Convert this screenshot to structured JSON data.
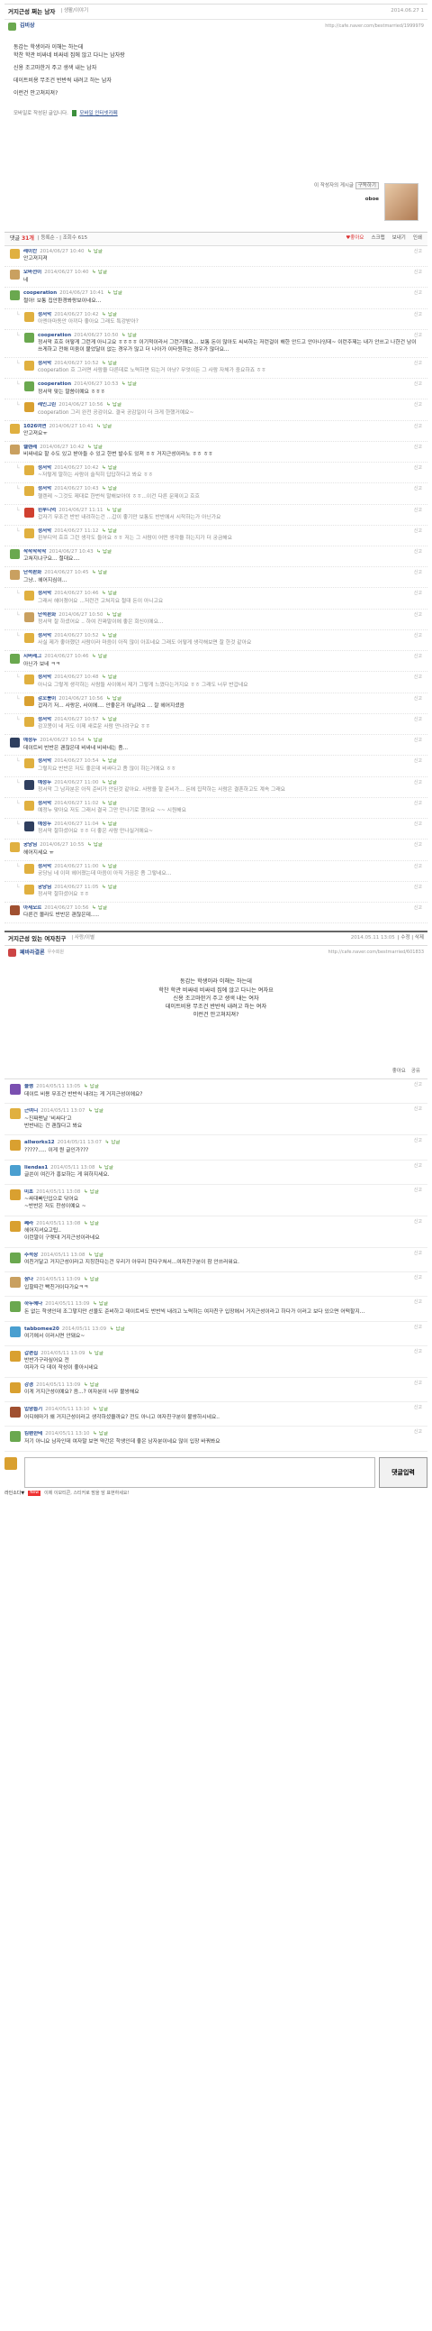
{
  "post1": {
    "title": "거지근성 쩌는 남자",
    "category": "| 생활/이야기",
    "date": "2014.06.27 1",
    "author": "김비상",
    "url": "http://cafe.naver.com/bestmarried/1999979",
    "lines": [
      "동갑는 학생이라 이해는 하는데",
      "학찬 학관 비싸네 비싸네 집에 않고 다니는 남자랑",
      "신용 조고마한거 주고 생색 내는 남자",
      "데이트비용 무조건 반반씩 내려고 하는 남자",
      "이런건 안고쳐지져?"
    ],
    "tag_prefix": "모바일로 작성된 글입니다.",
    "tag_link": "모바일 인터넷카페"
  },
  "profile": {
    "meta1": "이 작성자의 게시글",
    "meta2": "구독하기",
    "name": "oboe"
  },
  "comment_bar": {
    "label": "댓글",
    "count": "31개",
    "rest": "| 등록순 - | 조회수 615",
    "tools": [
      "♥좋아요",
      "스크랩",
      "보내기",
      "인쇄"
    ]
  },
  "comments": [
    {
      "name": "레이칸",
      "date": "2014/06/27 10:40",
      "text": "안고져지져",
      "reply": false,
      "color": "#e0b040",
      "dim": false
    },
    {
      "name": "오바전이",
      "date": "2014/06/27 10:40",
      "text": "네",
      "reply": false,
      "color": "#c9a060",
      "dim": false
    },
    {
      "name": "cooperation",
      "date": "2014/06/27 10:41",
      "text": "절아! 보통 집안환경봐랑보이네요...",
      "reply": false,
      "color": "#6aa84f",
      "dim": false
    },
    {
      "name": "정서막",
      "date": "2014/06/27 10:42",
      "text": "아엔아마동안 아끼다 좋아요 그래도 특강받아?",
      "reply": true,
      "color": "#e0b040",
      "dim": true
    },
    {
      "name": "cooperation",
      "date": "2014/06/27 10:50",
      "text": "정서막 흐흐 어떻게 그런게 아니고요 ㅎㅎㅎㅎ 이기적이라서 그런거예요... 보통 돈이 많아도 씨씨하는 저런걸이 해한 안드고 안아나잉데~ 이런주제는 내가 안쓰고 나한건 남이 쓰게하고 전애 미움이 붙었달이 없는 경우가 많고 더 나아가 이타원하는 경우가 많더요...",
      "reply": true,
      "color": "#6aa84f",
      "dim": false
    },
    {
      "name": "정서막",
      "date": "2014/06/27 10:52",
      "text": "cooperation 흐 그러면 사람을 다른데로 노력하면 되는거 아냥? 무엇이든 그 사람 자체가 중요하죠 ㅎㅎ",
      "reply": true,
      "color": "#e0b040",
      "dim": true
    },
    {
      "name": "cooperation",
      "date": "2014/06/27 10:53",
      "text": "정서막 맞는 말씀이예요 ㅎㅎㅎ",
      "reply": true,
      "color": "#6aa84f",
      "dim": false
    },
    {
      "name": "레인그린",
      "date": "2014/06/27 10:56",
      "text": "cooperation 그리 완전 공감이요. 결국 공감일이 더 크게 한했거예요~",
      "reply": true,
      "color": "#d9a030",
      "dim": true
    },
    {
      "name": "1026여면",
      "date": "2014/06/27 10:41",
      "text": "안고져요ㅠ",
      "reply": false,
      "color": "#e0b040",
      "dim": false
    },
    {
      "name": "헬렌레",
      "date": "2014/06/27 10:42",
      "text": "비싸네요 할 수도 있고 받아들 수 있고 한번 발수도 있져 ㅎㅎ 거지근성이라노 ㅎㅎ ㅎㅎ",
      "reply": false,
      "color": "#c9a060",
      "dim": false
    },
    {
      "name": "정서막",
      "date": "2014/06/27 10:42",
      "text": "~저렇게 말하는 사람이 솔직히 답답하다고 봐요 ㅎㅎ",
      "reply": true,
      "color": "#e0b040",
      "dim": true
    },
    {
      "name": "정서막",
      "date": "2014/06/27 10:43",
      "text": "헬렌레 ~그것도 제대로 한번씩 말해보아야 ㅎㅎ...이건 다른 문제이고 흐흐",
      "reply": true,
      "color": "#e0b040",
      "dim": true
    },
    {
      "name": "왼부디억",
      "date": "2014/06/27 11:11",
      "text": "갑자기 무조건 반반 내려하는건 ...갑이 좋기만 보통도 반반에서 시작하는가 아닌가요",
      "reply": true,
      "color": "#d04030",
      "dim": true
    },
    {
      "name": "정서막",
      "date": "2014/06/27 11:12",
      "text": "왼부디억 흐흐 그런 생각도 들어요 ㅎㅎ 저는 그 사람이 어떤 생각을 하는지가 더 궁금해요",
      "reply": true,
      "color": "#e0b040",
      "dim": true
    },
    {
      "name": "착착착착착",
      "date": "2014/06/27 10:43",
      "text": "고쳐지냐구요... 절대요....",
      "reply": false,
      "color": "#6aa84f",
      "dim": false
    },
    {
      "name": "단석판화",
      "date": "2014/06/27 10:45",
      "text": "그냥.. 헤어지심이...",
      "reply": false,
      "color": "#c9a060",
      "dim": false
    },
    {
      "name": "정서막",
      "date": "2014/06/27 10:46",
      "text": "그래서 헤어졌어요 ...저런건 고쳐지요 절대 돈이 아니고요",
      "reply": true,
      "color": "#e0b040",
      "dim": true
    },
    {
      "name": "단석판화",
      "date": "2014/06/27 10:50",
      "text": "정서막 잘 하셨어요 .. 하여 진짜말이에 좋은 회신이에요...",
      "reply": true,
      "color": "#c9a060",
      "dim": true
    },
    {
      "name": "정서막",
      "date": "2014/06/27 10:52",
      "text": "사실 제가 좋아했던 사람이라 마음이 아직 많이 아프네요 그래도 어떻게 생각해보면 잘 한것 같아요",
      "reply": true,
      "color": "#e0b040",
      "dim": true
    },
    {
      "name": "시버레그",
      "date": "2014/06/27 10:46",
      "text": "아닌가 보네 ㅋㅋ",
      "reply": false,
      "color": "#6aa84f",
      "dim": false
    },
    {
      "name": "정서막",
      "date": "2014/06/27 10:48",
      "text": "아니요 그렇게 생각하는 사람들 사이에서 제가 그렇게 느꼈다는거지요 ㅎㅎ 그래도 너무 반갑네요",
      "reply": true,
      "color": "#e0b040",
      "dim": true
    },
    {
      "name": "감꼬봉이",
      "date": "2014/06/27 10:56",
      "text": "갑자기 저... 사랑은, 사이에.... 안좋은거 아닐까요 ... 잘 헤어지셨음",
      "reply": true,
      "color": "#d9a030",
      "dim": false
    },
    {
      "name": "정서막",
      "date": "2014/06/27 10:57",
      "text": "감꼬봉이 네 저도 이제 새로운 사람 만나려구요 ㅎㅎ",
      "reply": true,
      "color": "#e0b040",
      "dim": true
    },
    {
      "name": "예정누",
      "date": "2014/06/27 10:54",
      "text": "데이트비 반반은 괜찮은데 비싸네 비싸네는 좀...",
      "reply": false,
      "color": "#2f3f5f",
      "dim": false
    },
    {
      "name": "정서막",
      "date": "2014/06/27 10:54",
      "text": "그렇지요 반반은 저도 좋은데 비싸다고 좀 많이 하는거에요 ㅎㅎ",
      "reply": true,
      "color": "#e0b040",
      "dim": true
    },
    {
      "name": "예정누",
      "date": "2014/06/27 11:00",
      "text": "정서막 그 남자분은 아직 준비가 안된것 같아요. 사랑을 할 준비가... 돈에 집착하는 사람은 결혼하고도 계속 그래요",
      "reply": true,
      "color": "#2f3f5f",
      "dim": true
    },
    {
      "name": "정서막",
      "date": "2014/06/27 11:02",
      "text": "예정누 맞아요 저도 그래서 결국 그만 만나기로 했어요 ~~ 시원해요",
      "reply": true,
      "color": "#e0b040",
      "dim": true
    },
    {
      "name": "예정누",
      "date": "2014/06/27 11:04",
      "text": "정서막 잘하셨어요 ㅎㅎ 더 좋은 사람 만나실거에요~",
      "reply": true,
      "color": "#2f3f5f",
      "dim": true
    },
    {
      "name": "궁당님",
      "date": "2014/06/27 10:55",
      "text": "헤어지세요 ㅠ",
      "reply": false,
      "color": "#e0b040",
      "dim": false
    },
    {
      "name": "정서막",
      "date": "2014/06/27 11:00",
      "text": "궁당님 네 이미 헤어졌는데 마음이 아직 가끔은 좀 그렇네요...",
      "reply": true,
      "color": "#e0b040",
      "dim": true
    },
    {
      "name": "궁당님",
      "date": "2014/06/27 11:05",
      "text": "정서막 잘하셨어요 ㅎㅎ",
      "reply": true,
      "color": "#e0b040",
      "dim": true
    },
    {
      "name": "아세모르",
      "date": "2014/06/27 10:56",
      "text": "다른건 몰라도 반반은 괜찮은데.....",
      "reply": false,
      "color": "#a05030",
      "dim": false
    }
  ],
  "post2": {
    "title": "거지근성 있는 여자친구",
    "category": "| 사랑/이별",
    "date": "2014.05.11 13:05",
    "actions": "| 수정 | 삭제",
    "author": "페바라결론",
    "author_tag": "우수회원",
    "url": "http://cafe.naver.com/bestmarried/601833",
    "lines": [
      "동갑는 학생이라 이해는 하는데",
      "학찬 학관 비싸네 비싸네 집에 않고 다니는 여자요",
      "신용 조고마한거 주고 생색 내는 여자",
      "데이트비용 무조건 반반씩 내려고 하는 여자",
      "이런건 안고쳐지져?"
    ],
    "like": "좋아요",
    "share": "공유"
  },
  "comments2": [
    {
      "name": "블랭",
      "date": "2014/05/11 13:05",
      "text": "데이트 비용 무조건 반반씩 내려는 게 거지근성이에요?",
      "color": "#7a4fb0"
    },
    {
      "name": "근여니",
      "date": "2014/05/11 13:07",
      "text": "~진짜맨날 '비싸다'고\n반반내는 건 괜찮다고 봐요",
      "color": "#e0b040"
    },
    {
      "name": "allworks12",
      "date": "2014/05/11 13:07",
      "text": "?????..... 이게 뭔 글인가???",
      "color": "#d9a030"
    },
    {
      "name": "liendas1",
      "date": "2014/05/11 13:08",
      "text": "글쓴이 여긴가 흥보하는 게 뭐하지세요.",
      "color": "#4a9fd0"
    },
    {
      "name": "미초",
      "date": "2014/05/11 13:08",
      "text": "~싸대빠딘입으로 닦어요\n~반반은 저도 찬성이예요 ~",
      "color": "#d9a030"
    },
    {
      "name": "쩨라",
      "date": "2014/05/11 13:08",
      "text": "헤어지셔요고팁..\n이런말이 구렛대 거지근성이라네요",
      "color": "#d9a030"
    },
    {
      "name": "추석상",
      "date": "2014/05/11 13:08",
      "text": "여친거달고 거지근성이라고 지칭한다는건 우리가 아무리 한다구쳐서...여자친구분이 참 안쓰러워요.",
      "color": "#6aa84f"
    },
    {
      "name": "삼다",
      "date": "2014/05/11 13:09",
      "text": "입할따간 빡친거이다가요ㅋㅋ",
      "color": "#c9a060"
    },
    {
      "name": "하누헤나",
      "date": "2014/05/11 13:09",
      "text": "돈 없는 학생인데 조그맣지만 선물도 준비하고 데이트비도 반반씩 내려고 노력하는 여자친구 입장에서 거지근성이라고 하다가 이러고 보다 있으면 어떡할지...",
      "color": "#6aa84f"
    },
    {
      "name": "tabbomee20",
      "date": "2014/05/11 13:09",
      "text": "여기에서 이러시면 안돼요~",
      "color": "#4a9fd0"
    },
    {
      "name": "갑편집",
      "date": "2014/05/11 13:09",
      "text": "반반가구라싶어요 전\n여자가 다 데이 작성이 좋아시네요",
      "color": "#d9a030"
    },
    {
      "name": "강경",
      "date": "2014/05/11 13:09",
      "text": "이게 거지근성이예요? 음...? 여자분이 너무 불쌍해요",
      "color": "#d9a030"
    },
    {
      "name": "입양돕기",
      "date": "2014/05/11 13:10",
      "text": "어디에마가 왜 거지근성이라고 생각하셨을까요? 전도 아니고 여자친구분이 불쌍하시네요..",
      "color": "#a05030"
    },
    {
      "name": "킴팬한테",
      "date": "2014/05/11 13:10",
      "text": "저기 아니요 남자인데 여자말 보면 약간은 학생인데 좋은 남자분이네요 많이 입장 바꿔봐요",
      "color": "#6aa84f"
    }
  ],
  "reply_label": "답글",
  "action_label": "신고",
  "writer": {
    "placeholder": "",
    "submit": "댓글입력",
    "nick": "라인소다▼",
    "new": "New",
    "hint": "이제 이모티콘, 스티커로 맘을 담 표현하세요!"
  }
}
